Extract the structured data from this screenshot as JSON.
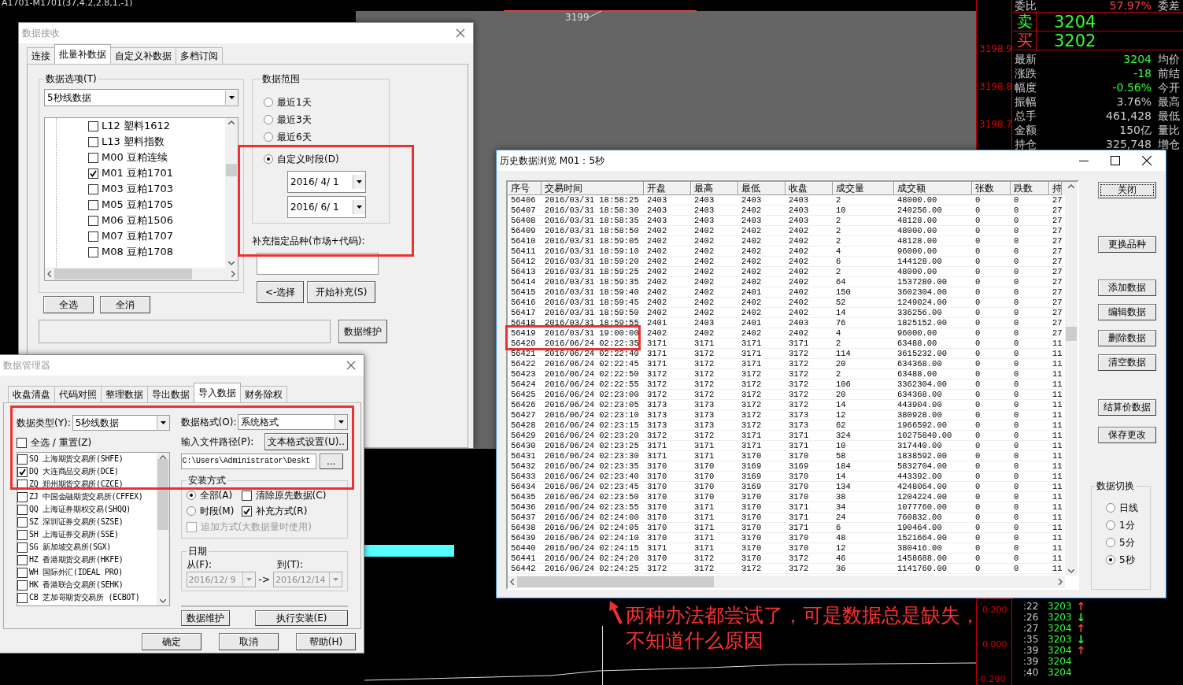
{
  "chart": {
    "title": "A1701-M1701(37,4.2,2.8,1,-1)",
    "price_marker": "3199",
    "axis_labels": [
      "3198.9",
      "3198.8",
      "3198.7"
    ],
    "lower_axis_labels": [
      "0.200",
      "0.000",
      "-0.200"
    ]
  },
  "quote_panel": {
    "ratio_label": "委比",
    "ratio_value": "57.97%",
    "ratio_label2": "委差",
    "sell": {
      "label": "卖",
      "price": "3204"
    },
    "buy": {
      "label": "买",
      "price": "3202"
    },
    "rows": [
      {
        "label": "最新",
        "value": "3204",
        "color": "#33ff33",
        "label2": "均价"
      },
      {
        "label": "涨跌",
        "value": "-18",
        "color": "#33ff33",
        "label2": "前结"
      },
      {
        "label": "幅度",
        "value": "-0.56%",
        "color": "#33ff33",
        "label2": "今开"
      },
      {
        "label": "振幅",
        "value": "3.76%",
        "color": "#cccccc",
        "label2": "最高"
      },
      {
        "label": "总手",
        "value": "461,428",
        "color": "#cccccc",
        "label2": "最低"
      },
      {
        "label": "金额",
        "value": "150亿",
        "color": "#cccccc",
        "label2": "量比"
      },
      {
        "label": "持仓",
        "value": "325,748",
        "color": "#cccccc",
        "label2": "增仓"
      }
    ]
  },
  "ticks": [
    {
      "time": ":22",
      "price": "3203",
      "arrow": "↑",
      "color": "#ff4040"
    },
    {
      "time": ":26",
      "price": "3203",
      "arrow": "↓",
      "color": "#33ff33"
    },
    {
      "time": ":27",
      "price": "3204",
      "arrow": "↑",
      "color": "#ff4040"
    },
    {
      "time": ":35",
      "price": "3203",
      "arrow": "↓",
      "color": "#33ff33"
    },
    {
      "time": ":39",
      "price": "3204",
      "arrow": "↑",
      "color": "#ff4040"
    },
    {
      "time": ":39",
      "price": "3204"
    },
    {
      "time": ":40",
      "price": "3204"
    }
  ],
  "receive_dialog": {
    "title": "数据接收",
    "active": false,
    "tabs": [
      {
        "label": "连接",
        "selected": false
      },
      {
        "label": "批量补数据",
        "selected": true
      },
      {
        "label": "自定义补数据",
        "selected": false
      },
      {
        "label": "多档订阅",
        "selected": false
      }
    ],
    "options_group": "数据选项(T)",
    "data_type": "5秒线数据",
    "items": [
      {
        "label": "L12 塑料1612",
        "checked": false
      },
      {
        "label": "L13 塑料指数",
        "checked": false
      },
      {
        "label": "M00 豆粕连续",
        "checked": false
      },
      {
        "label": "M01 豆粕1701",
        "checked": true
      },
      {
        "label": "M03 豆粕1703",
        "checked": false
      },
      {
        "label": "M05 豆粕1705",
        "checked": false
      },
      {
        "label": "M06 豆粕1506",
        "checked": false
      },
      {
        "label": "M07 豆粕1707",
        "checked": false
      },
      {
        "label": "M08 豆粕1708",
        "checked": false
      }
    ],
    "list_buttons": [
      "全选",
      "全消"
    ],
    "range_group": "数据范围",
    "ranges": [
      {
        "label": "最近1天",
        "selected": false
      },
      {
        "label": "最近3天",
        "selected": false
      },
      {
        "label": "最近6天",
        "selected": false
      },
      {
        "label": "自定义时段(D)",
        "selected": true
      }
    ],
    "dates": [
      "2016/  4/  1",
      "2016/  6/  1"
    ],
    "symbol_label": "补充指定品种(市场+代码):",
    "action_buttons": [
      "<-选择",
      "开始补充(S)"
    ],
    "maintain_button": "数据维护"
  },
  "manager_dialog": {
    "title": "数据管理器",
    "active": false,
    "tabs": [
      {
        "label": "收盘清盘",
        "selected": false
      },
      {
        "label": "代码对照",
        "selected": false
      },
      {
        "label": "整理数据",
        "selected": false
      },
      {
        "label": "导出数据",
        "selected": false
      },
      {
        "label": "导入数据",
        "selected": true
      },
      {
        "label": "财务除权",
        "selected": false
      }
    ],
    "type_label": "数据类型(Y):",
    "type_value": "5秒线数据",
    "select_all": {
      "label": "全选 / 重置(Z)",
      "checked": false
    },
    "exchanges": [
      {
        "label": "SQ 上海期货交易所(SHFE)",
        "checked": false
      },
      {
        "label": "DQ 大连商品交易所(DCE)",
        "checked": true
      },
      {
        "label": "ZQ 郑州期货交易所(CZCE)",
        "checked": false
      },
      {
        "label": "ZJ 中国金融期货交易所(CFFEX)",
        "checked": false
      },
      {
        "label": "QQ 上海证券期权交易(SHQQ)",
        "checked": false
      },
      {
        "label": "SZ 深圳证券交易所(SZSE)",
        "checked": false
      },
      {
        "label": "SH 上海证券交易所(SSE)",
        "checked": false
      },
      {
        "label": "SG 新加坡交易所(SGX)",
        "checked": false
      },
      {
        "label": "HZ 香港期货交易所(HKFE)",
        "checked": false
      },
      {
        "label": "WH 国际外汇(IDEAL PRO)",
        "checked": false
      },
      {
        "label": "HK 香港联合交易所(SEHK)",
        "checked": false
      },
      {
        "label": "CB 芝加哥期货交易所 (ECBOT)",
        "checked": false
      }
    ],
    "format_label": "数据格式(O):",
    "format_value": "系统格式",
    "path_label": "输入文件路径(P):",
    "text_format_button": "文本格式设置(U)..",
    "path_value": "C:\\Users\\Administrator\\Deskt",
    "browse_button": "...",
    "install_group": "安装方式",
    "install_modes": [
      {
        "label": "全部(A)",
        "selected": true
      },
      {
        "label": "时段(M)",
        "selected": false
      }
    ],
    "install_options": [
      {
        "label": "清除原先数据(C)",
        "checked": false,
        "disabled": false
      },
      {
        "label": "补充方式(R)",
        "checked": true,
        "disabled": false
      },
      {
        "label": "追加方式(大数据量时使用)",
        "checked": false,
        "disabled": true
      }
    ],
    "date_group": "日期",
    "from_label": "从(F):",
    "to_label": "到(T):",
    "from": "2016/12/ 9",
    "to": "2016/12/14",
    "range_arrow": "->",
    "dates_disabled": true,
    "progress": {
      "level": 0
    },
    "buttons": [
      "数据维护",
      "执行安装(E)"
    ],
    "footer_buttons": [
      "确定",
      "取消",
      "帮助(H)"
    ]
  },
  "browser_window": {
    "title": "历史数据浏览 M01：5秒",
    "active": true,
    "columns": [
      "序号",
      "交易时间",
      "开盘",
      "最高",
      "最低",
      "收盘",
      "成交量",
      "成交额",
      "张数",
      "跌数",
      "持"
    ],
    "rows": [
      [
        "56406",
        "2016/03/31 18:58:25",
        "2403",
        "2403",
        "2403",
        "2403",
        "2",
        "48000.00",
        "0",
        "0",
        "27"
      ],
      [
        "56407",
        "2016/03/31 18:58:30",
        "2403",
        "2403",
        "2402",
        "2403",
        "10",
        "240256.00",
        "0",
        "0",
        "27"
      ],
      [
        "56408",
        "2016/03/31 18:58:35",
        "2403",
        "2403",
        "2403",
        "2403",
        "2",
        "48128.00",
        "0",
        "0",
        "27"
      ],
      [
        "56409",
        "2016/03/31 18:58:50",
        "2402",
        "2402",
        "2402",
        "2402",
        "2",
        "48000.00",
        "0",
        "0",
        "27"
      ],
      [
        "56410",
        "2016/03/31 18:59:05",
        "2402",
        "2402",
        "2402",
        "2402",
        "2",
        "48128.00",
        "0",
        "0",
        "27"
      ],
      [
        "56411",
        "2016/03/31 18:59:10",
        "2402",
        "2402",
        "2402",
        "2402",
        "4",
        "96000.00",
        "0",
        "0",
        "27"
      ],
      [
        "56412",
        "2016/03/31 18:59:20",
        "2402",
        "2402",
        "2402",
        "2402",
        "6",
        "144128.00",
        "0",
        "0",
        "27"
      ],
      [
        "56413",
        "2016/03/31 18:59:25",
        "2402",
        "2402",
        "2402",
        "2402",
        "2",
        "48000.00",
        "0",
        "0",
        "27"
      ],
      [
        "56414",
        "2016/03/31 18:59:35",
        "2402",
        "2402",
        "2402",
        "2402",
        "64",
        "1537280.00",
        "0",
        "0",
        "27"
      ],
      [
        "56415",
        "2016/03/31 18:59:40",
        "2402",
        "2402",
        "2401",
        "2402",
        "150",
        "3602304.00",
        "0",
        "0",
        "27"
      ],
      [
        "56416",
        "2016/03/31 18:59:45",
        "2402",
        "2402",
        "2402",
        "2402",
        "52",
        "1249024.00",
        "0",
        "0",
        "27"
      ],
      [
        "56417",
        "2016/03/31 18:59:50",
        "2402",
        "2402",
        "2402",
        "2402",
        "14",
        "336256.00",
        "0",
        "0",
        "27"
      ],
      [
        "56418",
        "2016/03/31 18:59:55",
        "2401",
        "2403",
        "2401",
        "2403",
        "76",
        "1825152.00",
        "0",
        "0",
        "27"
      ],
      [
        "56419",
        "2016/03/31 19:00:00",
        "2402",
        "2402",
        "2402",
        "2402",
        "4",
        "96000.00",
        "0",
        "0",
        "27"
      ],
      [
        "56420",
        "2016/06/24 02:22:35",
        "3171",
        "3171",
        "3171",
        "3171",
        "2",
        "63488.00",
        "0",
        "0",
        "11"
      ],
      [
        "56421",
        "2016/06/24 02:22:40",
        "3171",
        "3172",
        "3171",
        "3172",
        "114",
        "3615232.00",
        "0",
        "0",
        "11"
      ],
      [
        "56422",
        "2016/06/24 02:22:45",
        "3171",
        "3172",
        "3171",
        "3172",
        "20",
        "634368.00",
        "0",
        "0",
        "11"
      ],
      [
        "56423",
        "2016/06/24 02:22:50",
        "3172",
        "3172",
        "3172",
        "3172",
        "2",
        "63488.00",
        "0",
        "0",
        "11"
      ],
      [
        "56424",
        "2016/06/24 02:22:55",
        "3172",
        "3172",
        "3172",
        "3172",
        "106",
        "3362304.00",
        "0",
        "0",
        "11"
      ],
      [
        "56425",
        "2016/06/24 02:23:00",
        "3172",
        "3172",
        "3172",
        "3172",
        "20",
        "634368.00",
        "0",
        "0",
        "11"
      ],
      [
        "56426",
        "2016/06/24 02:23:05",
        "3173",
        "3173",
        "3172",
        "3172",
        "14",
        "443904.00",
        "0",
        "0",
        "11"
      ],
      [
        "56427",
        "2016/06/24 02:23:10",
        "3173",
        "3173",
        "3172",
        "3173",
        "12",
        "380928.00",
        "0",
        "0",
        "11"
      ],
      [
        "56428",
        "2016/06/24 02:23:15",
        "3173",
        "3173",
        "3172",
        "3173",
        "62",
        "1966592.00",
        "0",
        "0",
        "11"
      ],
      [
        "56429",
        "2016/06/24 02:23:20",
        "3172",
        "3172",
        "3171",
        "3171",
        "324",
        "10275840.00",
        "0",
        "0",
        "11"
      ],
      [
        "56430",
        "2016/06/24 02:23:25",
        "3171",
        "3171",
        "3171",
        "3171",
        "10",
        "317440.00",
        "0",
        "0",
        "11"
      ],
      [
        "56431",
        "2016/06/24 02:23:30",
        "3171",
        "3171",
        "3170",
        "3170",
        "58",
        "1838592.00",
        "0",
        "0",
        "11"
      ],
      [
        "56432",
        "2016/06/24 02:23:35",
        "3170",
        "3170",
        "3169",
        "3169",
        "184",
        "5832704.00",
        "0",
        "0",
        "11"
      ],
      [
        "56433",
        "2016/06/24 02:23:40",
        "3170",
        "3170",
        "3169",
        "3170",
        "14",
        "443392.00",
        "0",
        "0",
        "11"
      ],
      [
        "56434",
        "2016/06/24 02:23:45",
        "3170",
        "3170",
        "3169",
        "3170",
        "134",
        "4248064.00",
        "0",
        "0",
        "11"
      ],
      [
        "56435",
        "2016/06/24 02:23:50",
        "3170",
        "3170",
        "3170",
        "3170",
        "38",
        "1204224.00",
        "0",
        "0",
        "11"
      ],
      [
        "56436",
        "2016/06/24 02:23:55",
        "3170",
        "3171",
        "3170",
        "3171",
        "34",
        "1077760.00",
        "0",
        "0",
        "11"
      ],
      [
        "56437",
        "2016/06/24 02:24:00",
        "3170",
        "3171",
        "3170",
        "3171",
        "24",
        "760832.00",
        "0",
        "0",
        "11"
      ],
      [
        "56438",
        "2016/06/24 02:24:05",
        "3170",
        "3171",
        "3170",
        "3171",
        "6",
        "190464.00",
        "0",
        "0",
        "11"
      ],
      [
        "56439",
        "2016/06/24 02:24:10",
        "3170",
        "3171",
        "3170",
        "3170",
        "48",
        "1521664.00",
        "0",
        "0",
        "11"
      ],
      [
        "56440",
        "2016/06/24 02:24:15",
        "3171",
        "3171",
        "3170",
        "3170",
        "12",
        "380416.00",
        "0",
        "0",
        "11"
      ],
      [
        "56441",
        "2016/06/24 02:24:20",
        "3170",
        "3172",
        "3170",
        "3172",
        "46",
        "1458688.00",
        "0",
        "0",
        "11"
      ],
      [
        "56442",
        "2016/06/24 02:24:25",
        "3172",
        "3172",
        "3172",
        "3172",
        "36",
        "1141760.00",
        "0",
        "0",
        "11"
      ]
    ],
    "side_buttons": [
      {
        "label": "关闭",
        "focused": true
      },
      {
        "label": "更换品种",
        "focused": false
      },
      {
        "label": "添加数据",
        "focused": false
      },
      {
        "label": "编辑数据",
        "focused": false
      },
      {
        "label": "删除数据",
        "focused": false
      },
      {
        "label": "清空数据",
        "focused": false
      },
      {
        "label": "结算价数据",
        "focused": false
      },
      {
        "label": "保存更改",
        "focused": false
      }
    ],
    "switch_group": "数据切换",
    "switch_options": [
      {
        "label": "日线",
        "selected": false
      },
      {
        "label": "1分",
        "selected": false
      },
      {
        "label": "5分",
        "selected": false
      },
      {
        "label": "5秒",
        "selected": true
      }
    ]
  },
  "annotation": {
    "lines": [
      "两种办法都尝试了，可是数据总是缺失，",
      "不知道什么原因"
    ]
  }
}
